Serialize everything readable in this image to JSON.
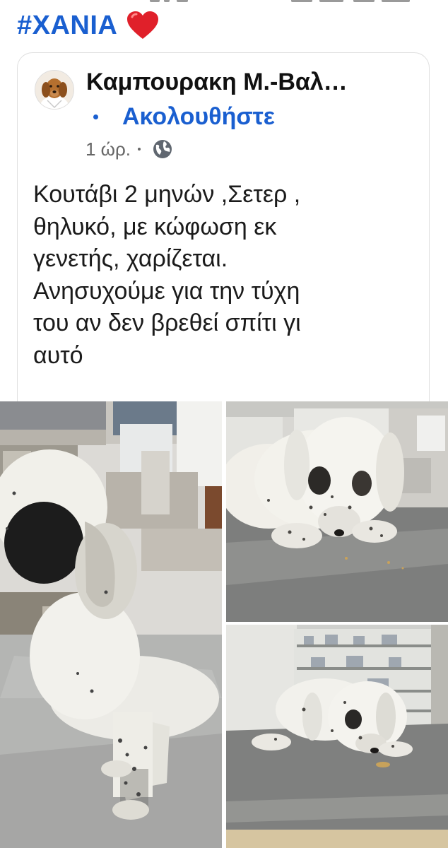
{
  "header": {
    "hashtag": "#ΧΑΝΙΑ",
    "emoji_icon": "red-heart-icon"
  },
  "post": {
    "author": "Καμπουρακη Μ.-Βαλ…",
    "follow_label": "Ακολουθήστε",
    "time": "1 ώρ.",
    "audience_icon": "globe-icon",
    "text": "Κουτάβι 2 μηνών ,Σετερ ,\nθηλυκό, με κώφωση εκ\nγενετής, χαρίζεται.\nΑνησυχούμε για την τύχη\nτου αν δεν βρεθεί σπίτι γι\nαυτό"
  },
  "colors": {
    "accent": "#1a5fd0",
    "heart": "#e0202a",
    "card_border": "#e0e0e0"
  },
  "photos": [
    "puppy-standing-photo",
    "puppy-lying-photo",
    "puppy-on-table-photo"
  ]
}
